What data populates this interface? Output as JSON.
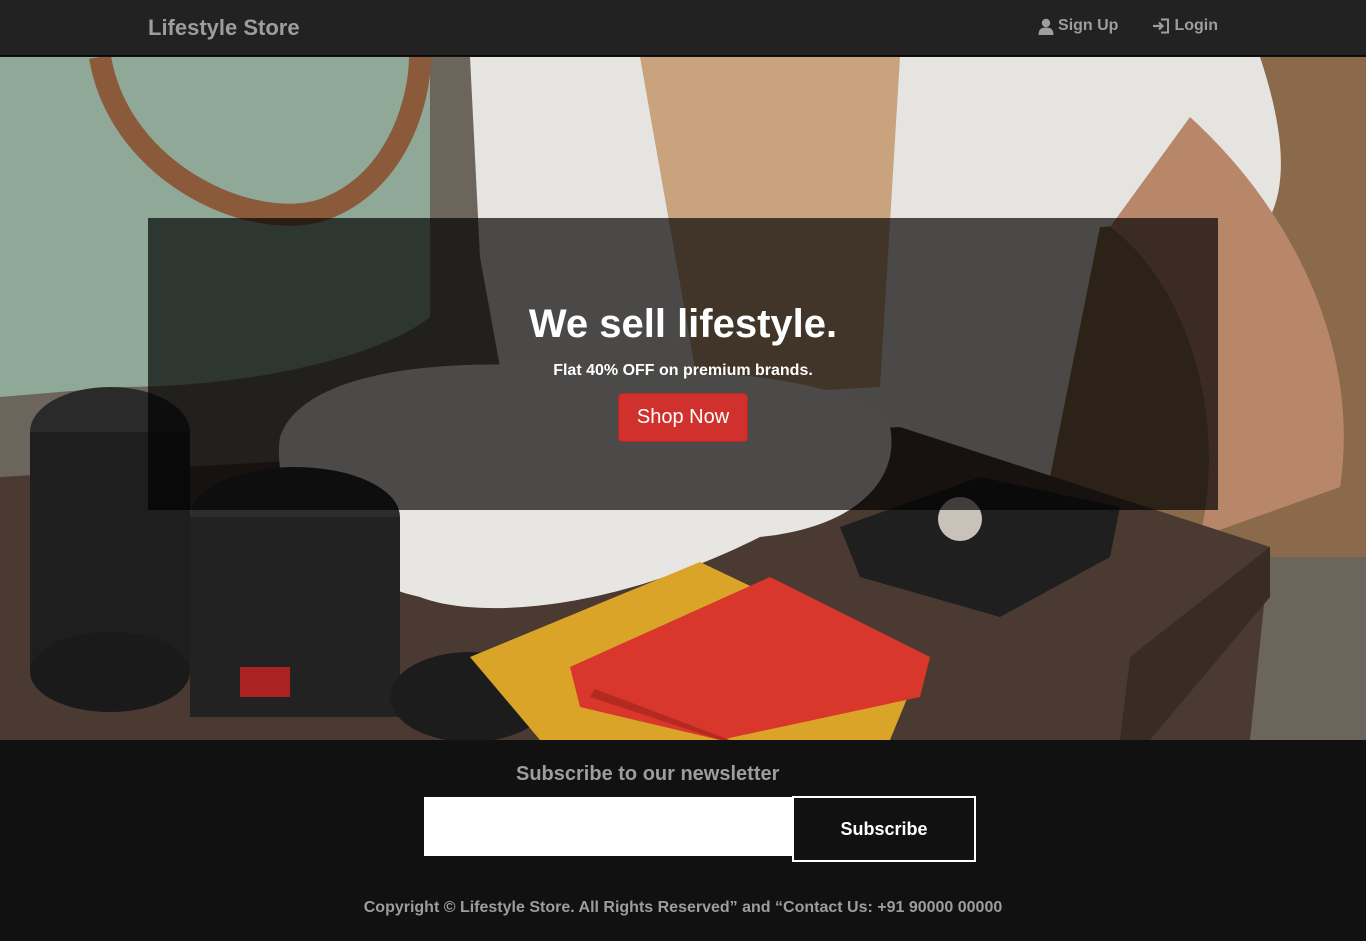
{
  "navbar": {
    "brand": "Lifestyle Store",
    "signup": {
      "icon": "user-icon",
      "label": "Sign Up"
    },
    "login": {
      "icon": "login-icon",
      "label": "Login"
    }
  },
  "hero": {
    "title": "We sell lifestyle.",
    "subtitle": "Flat 40% OFF on premium brands.",
    "cta_label": "Shop Now"
  },
  "newsletter": {
    "title": "Subscribe to our newsletter",
    "input_value": "",
    "button_label": "Subscribe"
  },
  "footer": {
    "copyright": "Copyright © Lifestyle Store. All Rights Reserved” and “Contact Us: +91 90000 00000"
  },
  "colors": {
    "navbar_bg": "#222222",
    "nav_text": "#9d9d9d",
    "cta_bg": "#d0312d",
    "footer_bg": "#111111"
  }
}
